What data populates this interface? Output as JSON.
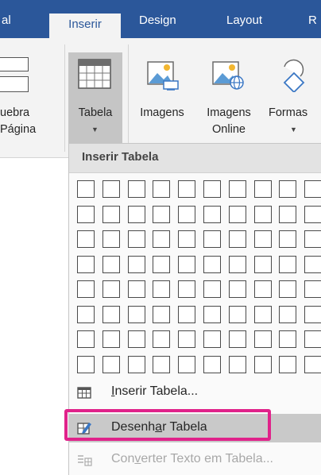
{
  "tabs": [
    {
      "label": "al",
      "active": false
    },
    {
      "label": "Inserir",
      "active": true
    },
    {
      "label": "Design",
      "active": false
    },
    {
      "label": "Layout",
      "active": false
    },
    {
      "label": "R",
      "active": false
    }
  ],
  "ribbon": {
    "page_break": {
      "line1": "uebra",
      "line2": "Página"
    },
    "table": {
      "label": "Tabela"
    },
    "images": {
      "label": "Imagens"
    },
    "online_images": {
      "line1": "Imagens",
      "line2": "Online"
    },
    "shapes": {
      "label": "Formas"
    }
  },
  "dropdown": {
    "header": "Inserir Tabela",
    "grid": {
      "columns": 10,
      "rows": 8
    },
    "items": [
      {
        "pre": "",
        "u": "I",
        "post": "nserir Tabela...",
        "icon": "table-icon",
        "disabled": false
      },
      {
        "pre": "Desenh",
        "u": "a",
        "post": "r Tabela",
        "icon": "draw-table-icon",
        "disabled": false,
        "highlighted": true
      },
      {
        "pre": "Con",
        "u": "v",
        "post": "erter Texto em Tabela...",
        "icon": "convert-text-icon",
        "disabled": true
      }
    ]
  },
  "colors": {
    "tab_bar": "#2b579a",
    "ribbon": "#f3f3f3",
    "highlight_border": "#e0228a"
  }
}
